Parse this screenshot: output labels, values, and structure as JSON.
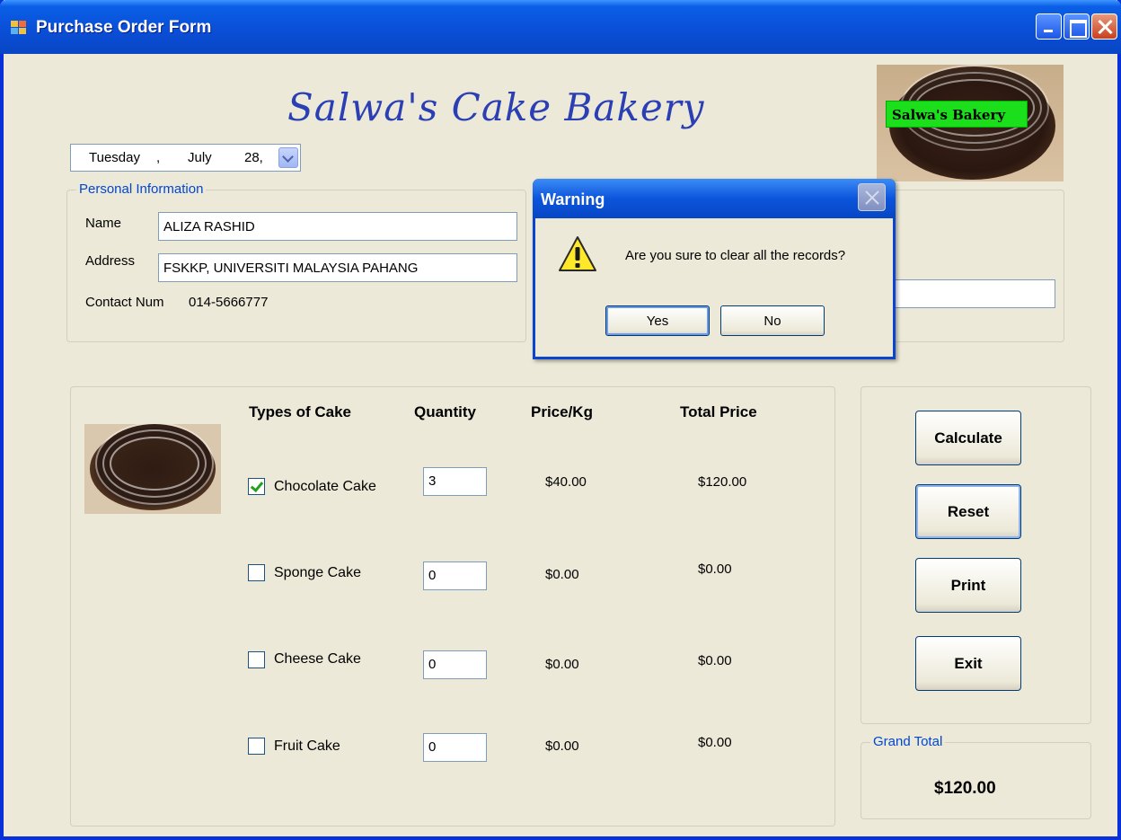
{
  "window": {
    "title": "Purchase Order Form"
  },
  "header": {
    "bakery_name": "Salwa's Cake Bakery",
    "logo_text": "Salwa's Bakery"
  },
  "date_picker": {
    "day": "Tuesday",
    "sep": ",",
    "month": "July",
    "date": "28,"
  },
  "personal": {
    "legend": "Personal Information",
    "name_label": "Name",
    "name_value": "ALIZA RASHID",
    "address_label": "Address",
    "address_value": "FSKKP, UNIVERSITI MALAYSIA PAHANG",
    "contact_label": "Contact Num",
    "contact_value": "014-5666777"
  },
  "order": {
    "headers": {
      "type": "Types of Cake",
      "quantity": "Quantity",
      "price": "Price/Kg",
      "total": "Total Price"
    },
    "rows": [
      {
        "name": "Chocolate Cake",
        "checked": true,
        "qty": "3",
        "price": "$40.00",
        "total": "$120.00"
      },
      {
        "name": "Sponge Cake",
        "checked": false,
        "qty": "0",
        "price": "$0.00",
        "total": "$0.00"
      },
      {
        "name": "Cheese Cake",
        "checked": false,
        "qty": "0",
        "price": "$0.00",
        "total": "$0.00"
      },
      {
        "name": "Fruit Cake",
        "checked": false,
        "qty": "0",
        "price": "$0.00",
        "total": "$0.00"
      }
    ]
  },
  "actions": {
    "calculate": "Calculate",
    "reset": "Reset",
    "print": "Print",
    "exit": "Exit"
  },
  "grand_total": {
    "legend": "Grand Total",
    "value": "$120.00"
  },
  "dialog": {
    "title": "Warning",
    "message": "Are you sure to clear all the records?",
    "yes": "Yes",
    "no": "No"
  },
  "colors": {
    "title_bar": "#0a4fd8",
    "group_legend": "#0046d5",
    "bakery_title": "#2b3fb5",
    "logo_label": "#1bdf1b"
  }
}
